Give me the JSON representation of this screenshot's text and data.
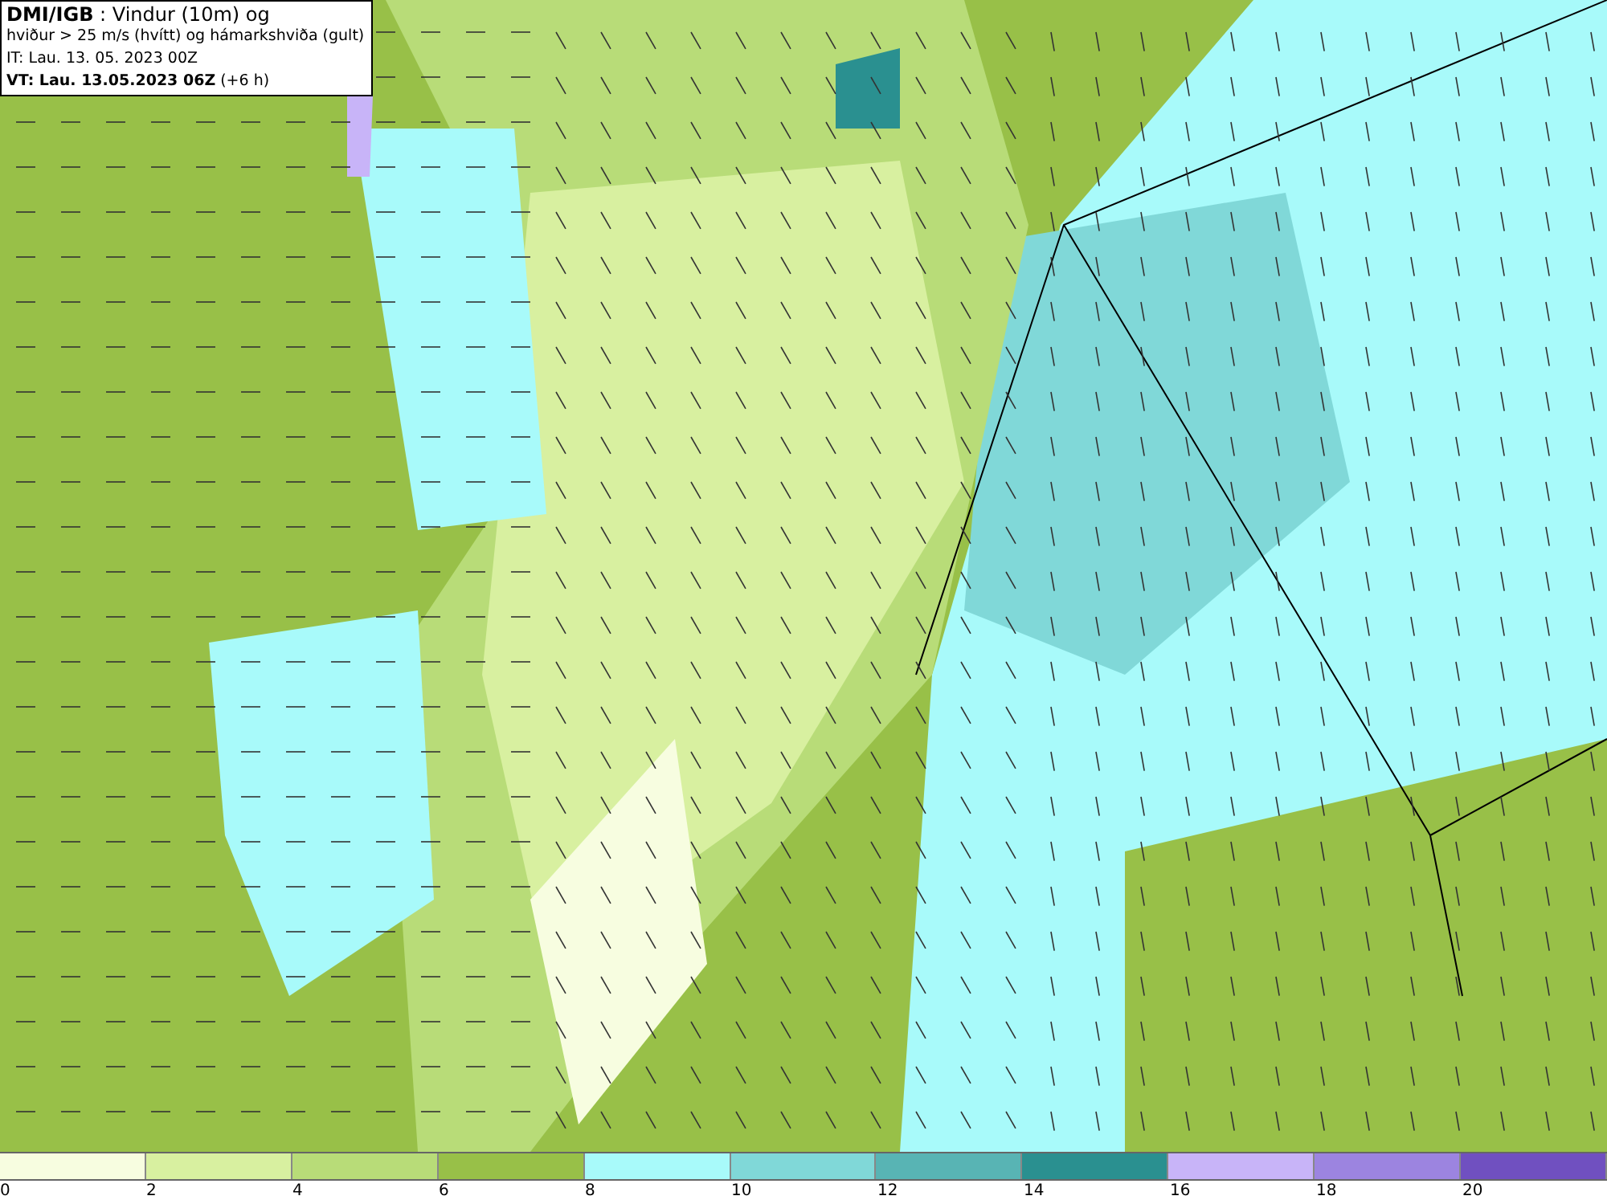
{
  "title_box": {
    "lines": [
      "**DMI/IGB** : Vindur (10m) og",
      "hviður > 25 m/s (hvítt) og hámarkshviða (gult)",
      "IT: Lau. 13. 05. 2023 00Z",
      "**VT: Lau. 13.05.2023 06Z** (+6 h)"
    ]
  },
  "legend": {
    "bins": [
      {
        "color": "#f7fde0"
      },
      {
        "color": "#d8f0a0"
      },
      {
        "color": "#b8dc78"
      },
      {
        "color": "#98c048"
      },
      {
        "color": "#a8fafa"
      },
      {
        "color": "#80d8d8"
      },
      {
        "color": "#58b4b4"
      },
      {
        "color": "#2a9090"
      },
      {
        "color": "#c8b4f8"
      },
      {
        "color": "#9c84e0"
      },
      {
        "color": "#7050c0"
      }
    ],
    "ticks": [
      "0",
      "2",
      "4",
      "6",
      "8",
      "10",
      "12",
      "14",
      "16",
      "18",
      "20"
    ]
  }
}
